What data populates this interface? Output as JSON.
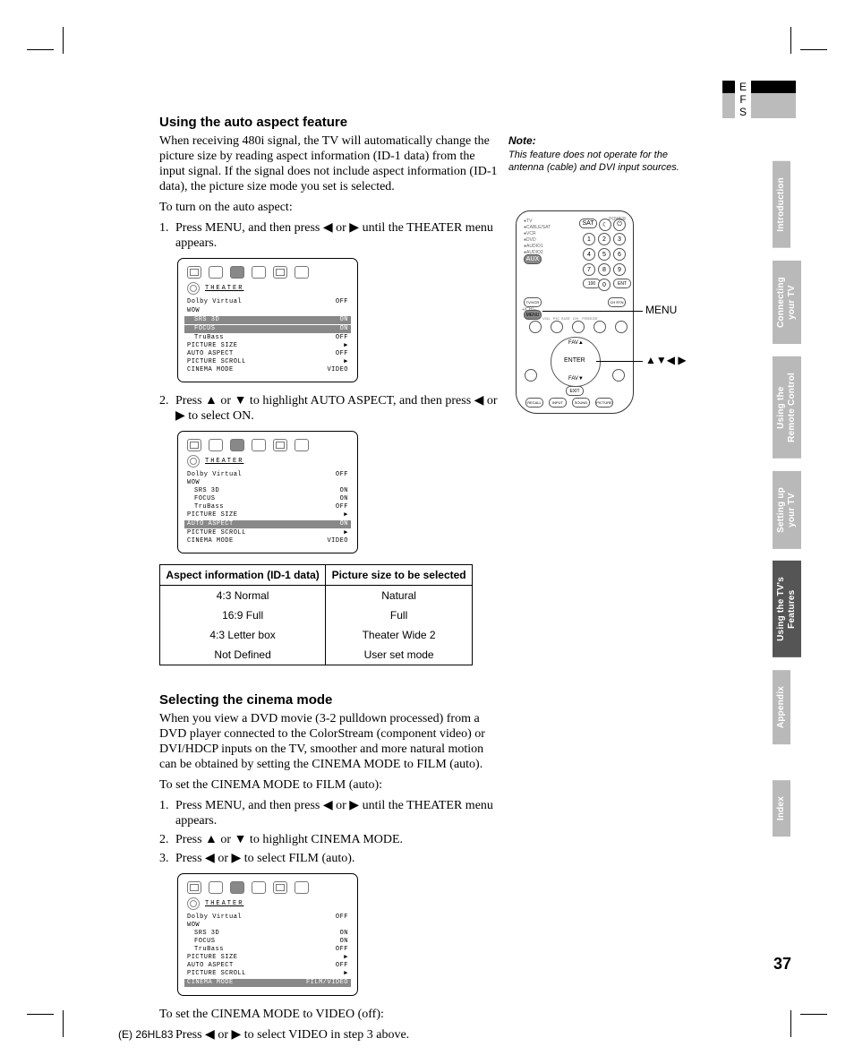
{
  "lang_tabs": {
    "e": "E",
    "f": "F",
    "s": "S"
  },
  "side_tabs": {
    "intro": "Introduction",
    "connect": "Connecting\nyour TV",
    "remote": "Using the\nRemote Control",
    "setup": "Setting up\nyour TV",
    "features": "Using the TV's\nFeatures",
    "appendix": "Appendix",
    "index": "Index"
  },
  "section1": {
    "heading": "Using the auto aspect feature",
    "p1": "When receiving 480i signal, the TV will automatically change the picture size by reading aspect information (ID-1 data) from the input signal. If the signal does not include aspect information (ID-1 data), the picture size mode you set is selected.",
    "p2": "To turn on the auto aspect:",
    "step1": "Press MENU, and then press ◀ or ▶ until the THEATER menu appears.",
    "step2": "Press ▲ or ▼ to highlight AUTO ASPECT, and then press ◀ or ▶ to select ON."
  },
  "osd": {
    "title": "THEATER",
    "rows": {
      "dolby": {
        "k": "Dolby Virtual",
        "v": "OFF"
      },
      "wow": {
        "k": "WOW",
        "v": ""
      },
      "srs": {
        "k": "SRS 3D",
        "v": "ON"
      },
      "focus": {
        "k": "FOCUS",
        "v": "ON"
      },
      "trubass": {
        "k": "TruBass",
        "v": "OFF"
      },
      "psize": {
        "k": "PICTURE SIZE",
        "v": "▶"
      },
      "aspect": {
        "k": "AUTO ASPECT",
        "v": "OFF"
      },
      "aspect_on": {
        "k": "AUTO ASPECT",
        "v": "ON"
      },
      "scroll": {
        "k": "PICTURE SCROLL",
        "v": "▶"
      },
      "cinema": {
        "k": "CINEMA MODE",
        "v": "VIDEO"
      },
      "cinema_sel": {
        "k": "CINEMA MODE",
        "v": "FILM/VIDEO"
      }
    }
  },
  "table": {
    "h1": "Aspect information (ID-1 data)",
    "h2": "Picture size to be selected",
    "r": [
      {
        "a": "4:3 Normal",
        "b": "Natural"
      },
      {
        "a": "16:9 Full",
        "b": "Full"
      },
      {
        "a": "4:3 Letter box",
        "b": "Theater Wide 2"
      },
      {
        "a": "Not Defined",
        "b": "User set mode"
      }
    ]
  },
  "note": {
    "h": "Note:",
    "body": "This feature does not operate for the antenna (cable) and DVI input sources."
  },
  "remote_labels": {
    "menu": "MENU",
    "dpad": "▲▼◀ ▶"
  },
  "section2": {
    "heading": "Selecting the cinema mode",
    "p1": "When you view a DVD movie (3-2 pulldown processed) from a DVD player connected to the ColorStream (component video) or DVI/HDCP inputs on the TV, smoother and more natural motion can be obtained by setting the CINEMA MODE to FILM (auto).",
    "p2": "To set the CINEMA MODE to FILM (auto):",
    "step1": "Press MENU, and then press ◀ or ▶ until the THEATER menu appears.",
    "step2": "Press ▲ or ▼ to highlight CINEMA MODE.",
    "step3": "Press ◀ or ▶ to select FILM (auto).",
    "p3": "To set the CINEMA MODE to VIDEO (off):",
    "p4": "Press ◀ or ▶ to select VIDEO in step 3 above."
  },
  "page_number": "37",
  "footer": "(E) 26HL83"
}
